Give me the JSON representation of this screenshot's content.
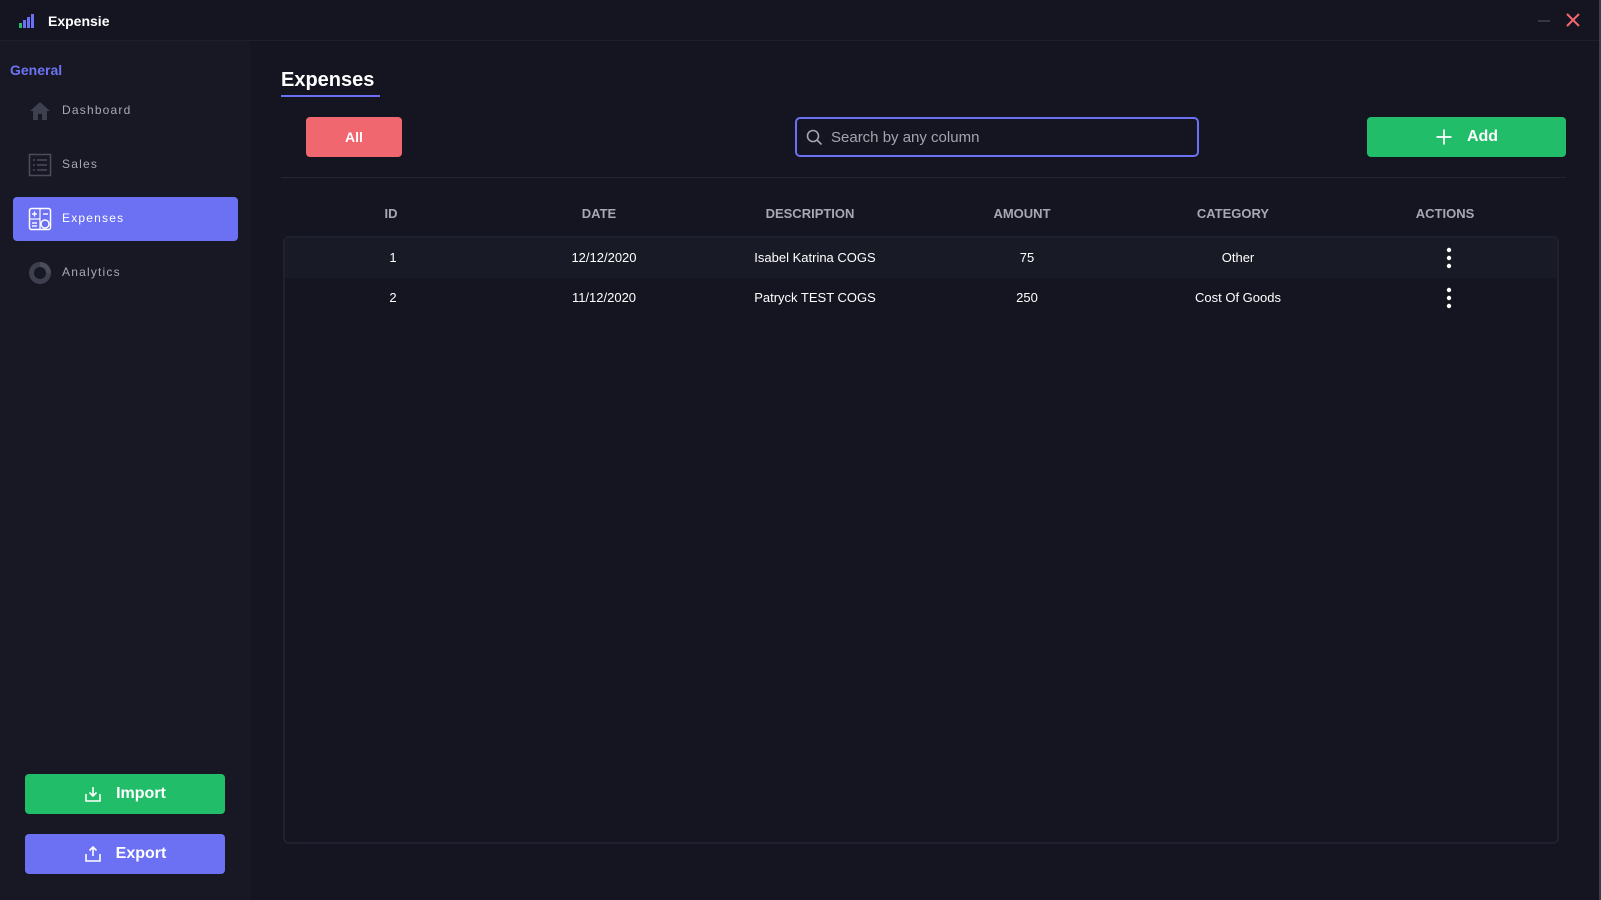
{
  "app": {
    "title": "Expensie"
  },
  "sidebar": {
    "section_label": "General",
    "items": [
      {
        "label": "Dashboard",
        "icon": "home-icon",
        "active": false
      },
      {
        "label": "Sales",
        "icon": "list-icon",
        "active": false
      },
      {
        "label": "Expenses",
        "icon": "expenses-icon",
        "active": true
      },
      {
        "label": "Analytics",
        "icon": "donut-chart-icon",
        "active": false
      }
    ],
    "import_label": "Import",
    "export_label": "Export"
  },
  "main": {
    "page_title": "Expenses",
    "filter_label": "All",
    "search": {
      "placeholder": "Search by any column",
      "value": ""
    },
    "add_label": "Add",
    "table": {
      "columns": [
        "ID",
        "DATE",
        "DESCRIPTION",
        "AMOUNT",
        "CATEGORY",
        "ACTIONS"
      ],
      "rows": [
        {
          "id": "1",
          "date": "12/12/2020",
          "description": "Isabel Katrina COGS",
          "amount": "75",
          "category": "Other"
        },
        {
          "id": "2",
          "date": "11/12/2020",
          "description": "Patryck TEST COGS",
          "amount": "250",
          "category": "Cost Of Goods"
        }
      ]
    }
  },
  "colors": {
    "accent": "#6b71f2",
    "success": "#21bd68",
    "danger": "#f1676f",
    "background": "#141520",
    "sidebar": "#171823"
  }
}
